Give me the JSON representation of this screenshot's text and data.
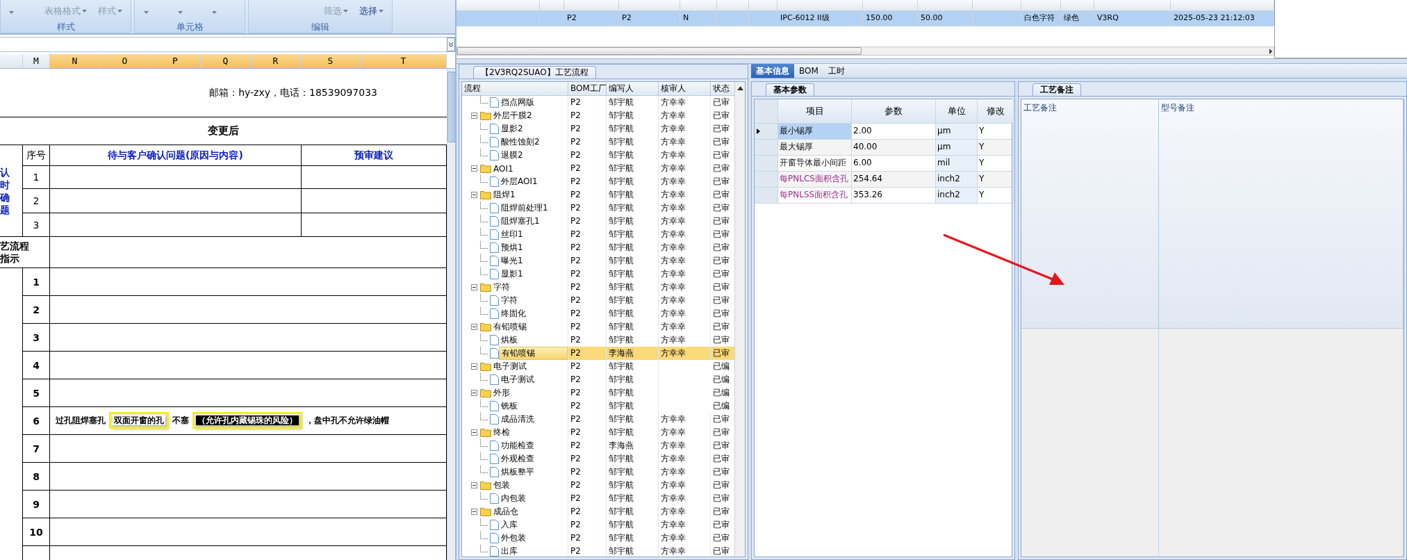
{
  "ribbon": {
    "groups": [
      {
        "label": "样式",
        "buttons": [
          {
            "label": "表格格式",
            "disabled": true
          },
          {
            "label": "样式",
            "disabled": true
          }
        ]
      },
      {
        "label": "单元格"
      },
      {
        "label": "编辑",
        "buttons": [
          {
            "label": "筛选",
            "disabled": true
          },
          {
            "label": "选择",
            "disabled": false
          }
        ]
      }
    ]
  },
  "sheet": {
    "columns": [
      {
        "label": "M",
        "selected": false
      },
      {
        "label": "N",
        "selected": true
      },
      {
        "label": "O",
        "selected": true
      },
      {
        "label": "P",
        "selected": true
      },
      {
        "label": "Q",
        "selected": true
      },
      {
        "label": "R",
        "selected": true
      },
      {
        "label": "S",
        "selected": true
      },
      {
        "label": "T",
        "selected": true
      }
    ],
    "contact": "邮箱：hy-zxy，电话：18539097033",
    "title": "变更后",
    "confirm_label": [
      "认",
      "时",
      "确",
      "题"
    ],
    "headers": [
      "序号",
      "待与客户确认问题(原因与内容)",
      "预审建议"
    ],
    "confirm_rows": [
      "1",
      "2",
      "3"
    ],
    "flow_label": [
      "艺流程",
      "指示"
    ],
    "process_rows": [
      {
        "no": "1"
      },
      {
        "no": "2"
      },
      {
        "no": "3"
      },
      {
        "no": "4"
      },
      {
        "no": "5"
      },
      {
        "no": "6",
        "segments": [
          {
            "text": "过孔阻焊塞孔",
            "boxed": false,
            "selected": false
          },
          {
            "text": "双面开窗的孔",
            "boxed": true,
            "selected": false
          },
          {
            "text": "不塞",
            "boxed": false,
            "selected": false
          },
          {
            "text": "（允许孔内藏锡珠的风险）",
            "boxed": true,
            "selected": true
          },
          {
            "text": "，盘中孔不允许绿油帽",
            "boxed": false,
            "selected": false
          }
        ]
      },
      {
        "no": "7"
      },
      {
        "no": "8"
      },
      {
        "no": "9"
      },
      {
        "no": "10"
      }
    ]
  },
  "top_grid": {
    "rows": [
      {
        "selected": true,
        "cells": [
          null,
          null,
          "P2",
          "P2",
          "N",
          null,
          null,
          "IPC-6012 II级",
          "150.00",
          "50.00",
          null,
          "白色字符",
          "绿色",
          "V3RQ",
          "2025-05-23 21:12:03"
        ]
      }
    ]
  },
  "flow_panel": {
    "tab": "【2V3RQ2SUAO】工艺流程",
    "columns": [
      "流程",
      "BOM工厂",
      "编写人",
      "核审人",
      "状态"
    ],
    "tree": [
      {
        "children": [
          {
            "label": "挡点网版",
            "factory": "P2",
            "writer": "邹宇航",
            "reviewer": "方幸幸",
            "status": "已审",
            "selected": false
          }
        ]
      },
      {
        "label": "外层干膜2",
        "factory": "P2",
        "writer": "邹宇航",
        "reviewer": "方幸幸",
        "status": "已审",
        "selected": false,
        "children": [
          {
            "label": "显影2",
            "factory": "P2",
            "writer": "邹宇航",
            "reviewer": "方幸幸",
            "status": "已审",
            "selected": false
          },
          {
            "label": "酸性蚀刻2",
            "factory": "P2",
            "writer": "邹宇航",
            "reviewer": "方幸幸",
            "status": "已审",
            "selected": false
          },
          {
            "label": "退膜2",
            "factory": "P2",
            "writer": "邹宇航",
            "reviewer": "方幸幸",
            "status": "已审",
            "selected": false
          }
        ]
      },
      {
        "label": "AOI1",
        "factory": "P2",
        "writer": "邹宇航",
        "reviewer": "方幸幸",
        "status": "已审",
        "selected": false,
        "children": [
          {
            "label": "外层AOI1",
            "factory": "P2",
            "writer": "邹宇航",
            "reviewer": "方幸幸",
            "status": "已审",
            "selected": false
          }
        ]
      },
      {
        "label": "阻焊1",
        "factory": "P2",
        "writer": "邹宇航",
        "reviewer": "方幸幸",
        "status": "已审",
        "selected": false,
        "children": [
          {
            "label": "阻焊前处理1",
            "factory": "P2",
            "writer": "邹宇航",
            "reviewer": "方幸幸",
            "status": "已审",
            "selected": false
          },
          {
            "label": "阻焊塞孔1",
            "factory": "P2",
            "writer": "邹宇航",
            "reviewer": "方幸幸",
            "status": "已审",
            "selected": false
          },
          {
            "label": "丝印1",
            "factory": "P2",
            "writer": "邹宇航",
            "reviewer": "方幸幸",
            "status": "已审",
            "selected": false
          },
          {
            "label": "预烘1",
            "factory": "P2",
            "writer": "邹宇航",
            "reviewer": "方幸幸",
            "status": "已审",
            "selected": false
          },
          {
            "label": "曝光1",
            "factory": "P2",
            "writer": "邹宇航",
            "reviewer": "方幸幸",
            "status": "已审",
            "selected": false
          },
          {
            "label": "显影1",
            "factory": "P2",
            "writer": "邹宇航",
            "reviewer": "方幸幸",
            "status": "已审",
            "selected": false
          }
        ]
      },
      {
        "label": "字符",
        "factory": "P2",
        "writer": "邹宇航",
        "reviewer": "方幸幸",
        "status": "已审",
        "selected": false,
        "children": [
          {
            "label": "字符",
            "factory": "P2",
            "writer": "邹宇航",
            "reviewer": "方幸幸",
            "status": "已审",
            "selected": false
          },
          {
            "label": "终固化",
            "factory": "P2",
            "writer": "邹宇航",
            "reviewer": "方幸幸",
            "status": "已审",
            "selected": false
          }
        ]
      },
      {
        "label": "有铅喷锡",
        "factory": "P2",
        "writer": "邹宇航",
        "reviewer": "方幸幸",
        "status": "已审",
        "selected": false,
        "children": [
          {
            "label": "烘板",
            "factory": "P2",
            "writer": "邹宇航",
            "reviewer": "方幸幸",
            "status": "已审",
            "selected": false
          },
          {
            "label": "有铅喷锡",
            "factory": "P2",
            "writer": "李海燕",
            "reviewer": "方幸幸",
            "status": "已审",
            "selected": true
          }
        ]
      },
      {
        "label": "电子测试",
        "factory": "P2",
        "writer": "邹宇航",
        "status": "已编",
        "selected": false,
        "children": [
          {
            "label": "电子测试",
            "factory": "P2",
            "writer": "邹宇航",
            "status": "已编",
            "selected": false
          }
        ]
      },
      {
        "label": "外形",
        "factory": "P2",
        "writer": "邹宇航",
        "status": "已编",
        "selected": false,
        "children": [
          {
            "label": "铣板",
            "factory": "P2",
            "writer": "邹宇航",
            "status": "已编",
            "selected": false
          },
          {
            "label": "成品清洗",
            "factory": "P2",
            "writer": "邹宇航",
            "reviewer": "方幸幸",
            "status": "已审",
            "selected": false
          }
        ]
      },
      {
        "label": "终检",
        "factory": "P2",
        "writer": "邹宇航",
        "reviewer": "方幸幸",
        "status": "已审",
        "selected": false,
        "children": [
          {
            "label": "功能检查",
            "factory": "P2",
            "writer": "李海燕",
            "reviewer": "方幸幸",
            "status": "已审",
            "selected": false
          },
          {
            "label": "外观检查",
            "factory": "P2",
            "writer": "邹宇航",
            "reviewer": "方幸幸",
            "status": "已审",
            "selected": false
          },
          {
            "label": "烘板整平",
            "factory": "P2",
            "writer": "邹宇航",
            "reviewer": "方幸幸",
            "status": "已审",
            "selected": false
          }
        ]
      },
      {
        "label": "包装",
        "factory": "P2",
        "writer": "邹宇航",
        "reviewer": "方幸幸",
        "status": "已审",
        "selected": false,
        "children": [
          {
            "label": "内包装",
            "factory": "P2",
            "writer": "邹宇航",
            "reviewer": "方幸幸",
            "status": "已审",
            "selected": false
          }
        ]
      },
      {
        "label": "成品仓",
        "factory": "P2",
        "writer": "邹宇航",
        "reviewer": "方幸幸",
        "status": "已审",
        "selected": false,
        "children": [
          {
            "label": "入库",
            "factory": "P2",
            "writer": "邹宇航",
            "reviewer": "方幸幸",
            "status": "已审",
            "selected": false
          },
          {
            "label": "外包装",
            "factory": "P2",
            "writer": "邹宇航",
            "reviewer": "方幸幸",
            "status": "已审",
            "selected": false
          },
          {
            "label": "出库",
            "factory": "P2",
            "writer": "邹宇航",
            "reviewer": "方幸幸",
            "status": "已审",
            "selected": false
          }
        ]
      }
    ]
  },
  "info_tabs": [
    {
      "label": "基本信息",
      "selected": true
    },
    {
      "label": "BOM",
      "selected": false
    },
    {
      "label": "工时",
      "selected": false
    }
  ],
  "params": {
    "tab": "基本参数",
    "columns": [
      "项目",
      "参数",
      "单位",
      "修改"
    ],
    "rows": [
      {
        "item": "最小锡厚",
        "value": "2.00",
        "unit": "μm",
        "editable": "Y",
        "selected": true
      },
      {
        "item": "最大锡厚",
        "value": "40.00",
        "unit": "μm",
        "editable": "Y",
        "selected": false
      },
      {
        "item": "开窗导体最小间距",
        "value": "6.00",
        "unit": "mil",
        "editable": "Y",
        "selected": false
      },
      {
        "item": "每PNLCS面积含孔",
        "value": "254.64",
        "unit": "inch2",
        "editable": "Y",
        "selected": false,
        "color": "#a0288c"
      },
      {
        "item": "每PNLSS面积含孔",
        "value": "353.26",
        "unit": "inch2",
        "editable": "Y",
        "selected": false,
        "color": "#a0288c"
      }
    ]
  },
  "notes": {
    "tab": "工艺备注",
    "columns": [
      "工艺备注",
      "型号备注"
    ]
  }
}
